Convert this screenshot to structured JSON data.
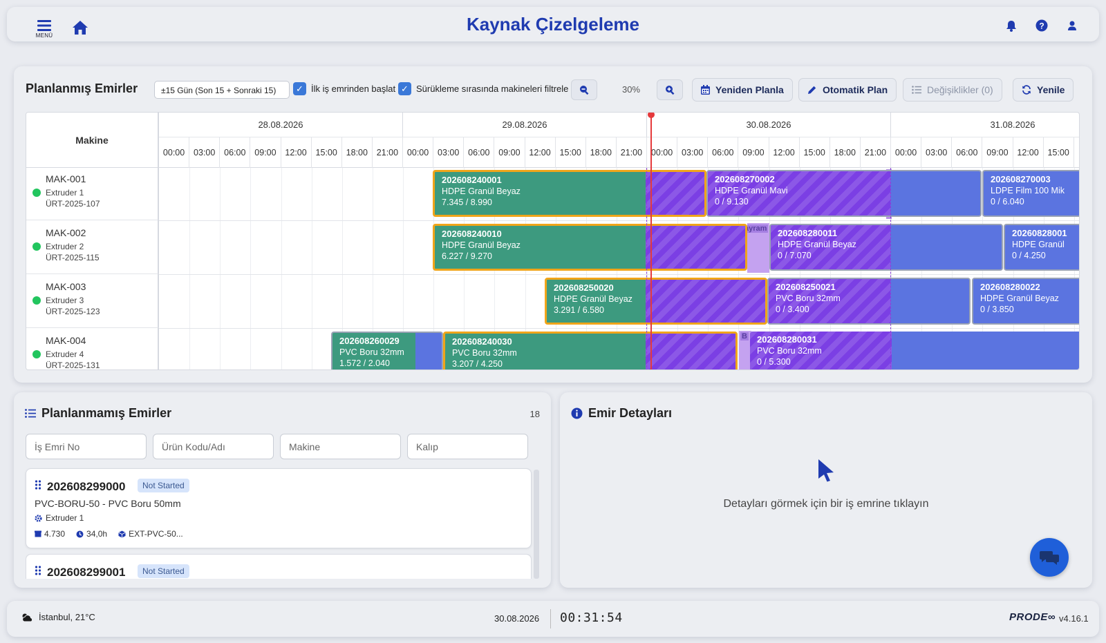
{
  "header": {
    "menu_label": "MENÜ",
    "title": "Kaynak Çizelgeleme"
  },
  "schedule": {
    "title": "Planlanmış Emirler",
    "range_select": "±15 Gün (Son 15 + Sonraki 15)",
    "checkbox_first_order": "İlk iş emrinden başlat",
    "checkbox_filter_machines": "Sürükleme sırasında makineleri filtrele",
    "zoom_level": "30%",
    "btn_replan": "Yeniden Planla",
    "btn_auto_plan": "Otomatik Plan",
    "btn_changes": "Değişiklikler (0)",
    "btn_refresh": "Yenile",
    "machine_header": "Makine",
    "dates": [
      "28.08.2026",
      "29.08.2026",
      "30.08.2026",
      "31.08.2026"
    ],
    "hours": [
      "00:00",
      "03:00",
      "06:00",
      "09:00",
      "12:00",
      "15:00",
      "18:00",
      "21:00",
      "00:00",
      "03:00",
      "06:00",
      "09:00",
      "12:00",
      "15:00",
      "18:00",
      "21:00",
      "00:00",
      "03:00",
      "06:00",
      "09:00",
      "12:00",
      "15:00",
      "18:00",
      "21:00",
      "00:00",
      "03:00",
      "06:00",
      "09:00",
      "12:00",
      "15:00"
    ],
    "machines": [
      {
        "code": "MAK-001",
        "name": "Extruder 1",
        "order": "ÜRT-2025-107"
      },
      {
        "code": "MAK-002",
        "name": "Extruder 2",
        "order": "ÜRT-2025-115"
      },
      {
        "code": "MAK-003",
        "name": "Extruder 3",
        "order": "ÜRT-2025-123"
      },
      {
        "code": "MAK-004",
        "name": "Extruder 4",
        "order": "ÜRT-2025-131"
      }
    ],
    "bars": [
      {
        "no": "202608240001",
        "product": "HDPE Granül Beyaz",
        "qty": "7.345 / 8.990"
      },
      {
        "no": "202608270002",
        "product": "HDPE Granül Mavi",
        "qty": "0 / 9.130"
      },
      {
        "no": "202608270003",
        "product": "LDPE Film 100 Mik",
        "qty": "0 / 6.040"
      },
      {
        "no": "202608240010",
        "product": "HDPE Granül Beyaz",
        "qty": "6.227 / 9.270"
      },
      {
        "no": "202608280011",
        "product": "HDPE Granül Beyaz",
        "qty": "0 / 7.070"
      },
      {
        "no": "20260828001",
        "product": "HDPE Granül",
        "qty": "0 / 4.250"
      },
      {
        "no": "202608250020",
        "product": "HDPE Granül Beyaz",
        "qty": "3.291 / 6.580"
      },
      {
        "no": "202608250021",
        "product": "PVC Boru 32mm",
        "qty": "0 / 3.400"
      },
      {
        "no": "202608280022",
        "product": "HDPE Granül Beyaz",
        "qty": "0 / 3.850"
      },
      {
        "no": "202608260029",
        "product": "PVC Boru 32mm",
        "qty": "1.572 / 2.040"
      },
      {
        "no": "202608240030",
        "product": "PVC Boru 32mm",
        "qty": "3.207 / 4.250"
      },
      {
        "no": "202608280031",
        "product": "PVC Boru 32mm",
        "qty": "0 / 5.300"
      }
    ],
    "holiday_label": "ayram",
    "holiday_label_short": "B"
  },
  "unplanned": {
    "title": "Planlanmamış Emirler",
    "count": "18",
    "filters": {
      "order_no": "İş Emri No",
      "product": "Ürün Kodu/Adı",
      "machine": "Makine",
      "mold": "Kalıp"
    },
    "cards": [
      {
        "no": "202608299000",
        "status": "Not Started",
        "product": "PVC-BORU-50 - PVC Boru 50mm",
        "machine": "Extruder 1",
        "qty": "4.730",
        "duration": "34,0h",
        "mold": "EXT-PVC-50..."
      },
      {
        "no": "202608299001",
        "status": "Not Started"
      }
    ]
  },
  "details": {
    "title": "Emir Detayları",
    "empty_message": "Detayları görmek için bir iş emrine tıklayın"
  },
  "footer": {
    "weather": "İstanbul, 21°C",
    "date": "30.08.2026",
    "time": "00:31:54",
    "logo": "PRODE∞",
    "version": "v4.16.1"
  },
  "colors": {
    "accent": "#1f3bb0",
    "started_bar": "#3d9a7f",
    "planned_bar": "#5b74e0",
    "locked_overlay": "#7b3fe4",
    "in_progress_border": "#f0a51a",
    "now_line": "#e5393b"
  }
}
